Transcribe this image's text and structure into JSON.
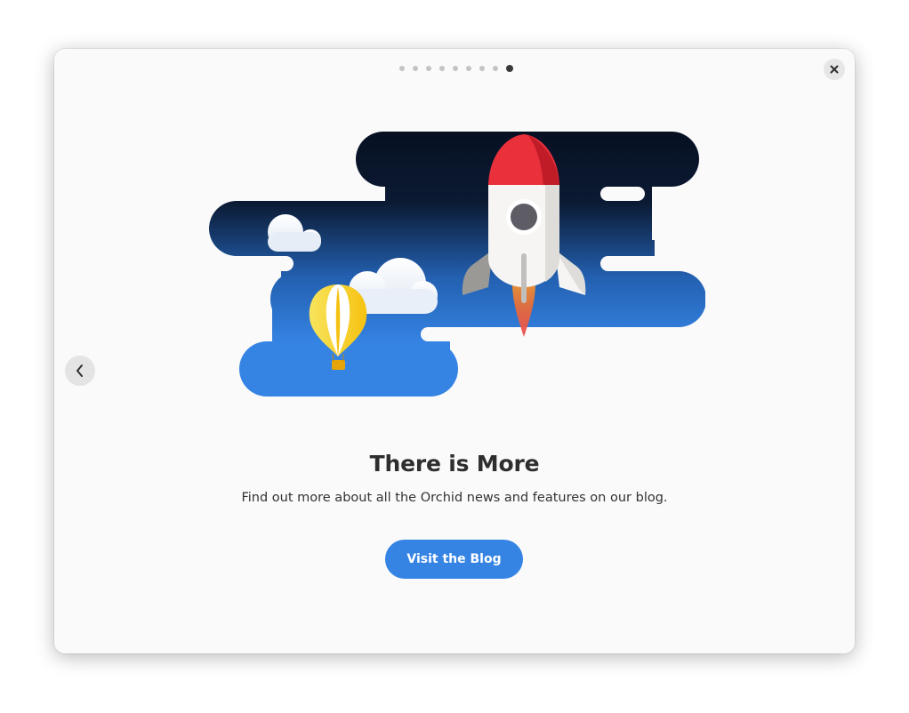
{
  "pager": {
    "total_pages": 9,
    "current_page": 9
  },
  "icons": {
    "close": "close-icon",
    "previous": "chevron-left-icon"
  },
  "page": {
    "title": "There is More",
    "description": "Find out more about all the Orchid news and features on our blog.",
    "button_label": "Visit the Blog"
  },
  "colors": {
    "accent": "#3584e4",
    "sky_dark": "#0a1224",
    "rocket_red": "#e9303b",
    "balloon_yellow": "#f5c211"
  }
}
